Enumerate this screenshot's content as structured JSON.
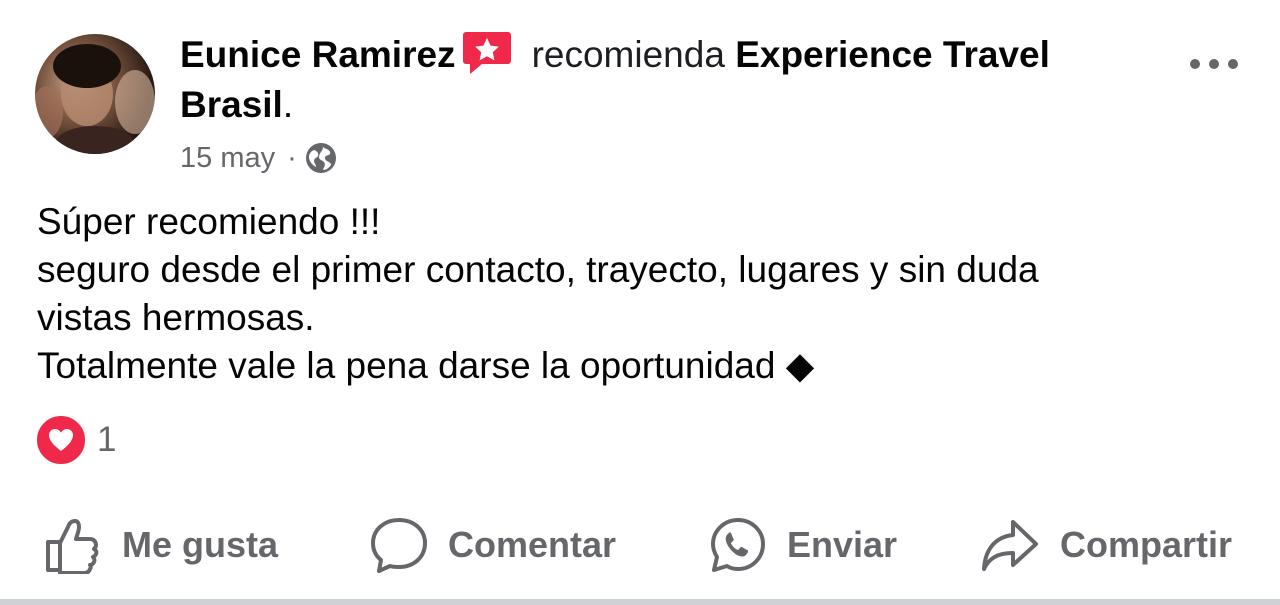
{
  "post": {
    "author": "Eunice Ramirez",
    "verb": "recomienda",
    "page_name_line1": "Experience Travel",
    "page_name_line2": "Brasil",
    "period": ".",
    "date": "15 may",
    "separator": "·",
    "privacy_icon": "globe-icon",
    "body_lines": [
      "Súper recomiendo !!!",
      "seguro desde el primer contacto, trayecto, lugares y sin duda",
      "vistas hermosas.",
      "Totalmente vale la pena darse la oportunidad"
    ],
    "trailing_glyph": "◆"
  },
  "reactions": {
    "type": "heart-icon",
    "count": "1"
  },
  "actions": {
    "like": "Me gusta",
    "comment": "Comentar",
    "send": "Enviar",
    "share": "Compartir"
  },
  "colors": {
    "recommend_badge": "#f0284a",
    "heart": "#f0284a",
    "secondary_text": "#65676b",
    "primary_text": "#050505"
  }
}
